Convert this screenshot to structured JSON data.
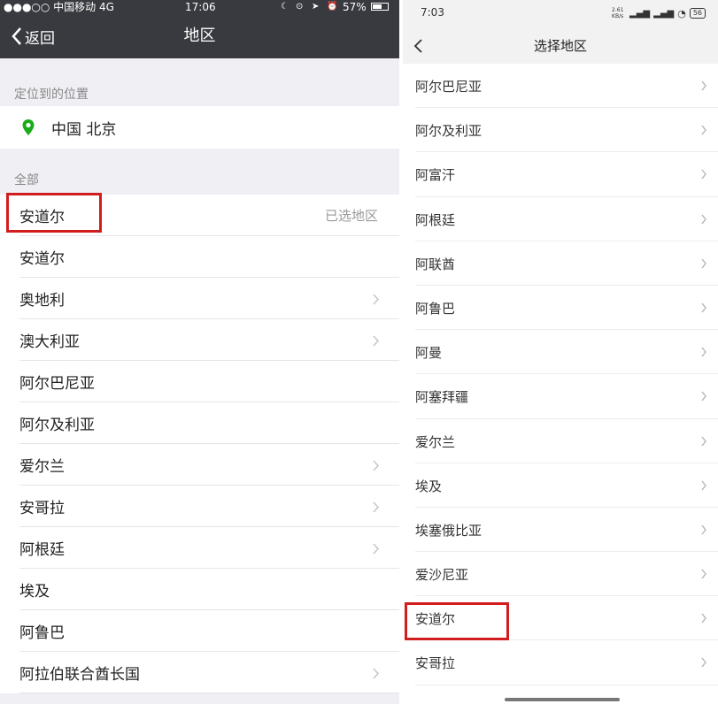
{
  "left": {
    "status": {
      "carrier": "●●●○○ 中国移动",
      "network": "4G",
      "time": "17:06",
      "battery": "57%"
    },
    "nav": {
      "back_label": "返回",
      "title": "地区"
    },
    "location_section": "定位到的位置",
    "location_value": "中国 北京",
    "all_section": "全部",
    "selected_label": "已选地区",
    "rows": [
      {
        "name": "安道尔",
        "chevron": false,
        "selected": true
      },
      {
        "name": "安道尔",
        "chevron": false
      },
      {
        "name": "奥地利",
        "chevron": true
      },
      {
        "name": "澳大利亚",
        "chevron": true
      },
      {
        "name": "阿尔巴尼亚",
        "chevron": false
      },
      {
        "name": "阿尔及利亚",
        "chevron": false
      },
      {
        "name": "爱尔兰",
        "chevron": true
      },
      {
        "name": "安哥拉",
        "chevron": true
      },
      {
        "name": "阿根廷",
        "chevron": true
      },
      {
        "name": "埃及",
        "chevron": false
      },
      {
        "name": "阿鲁巴",
        "chevron": false
      },
      {
        "name": "阿拉伯联合酋长国",
        "chevron": true
      }
    ]
  },
  "right": {
    "status": {
      "time": "7:03",
      "speed": "2.61 KB/s",
      "battery": "56"
    },
    "nav": {
      "title": "选择地区"
    },
    "rows": [
      "阿尔巴尼亚",
      "阿尔及利亚",
      "阿富汗",
      "阿根廷",
      "阿联酋",
      "阿鲁巴",
      "阿曼",
      "阿塞拜疆",
      "爱尔兰",
      "埃及",
      "埃塞俄比亚",
      "爱沙尼亚",
      "安道尔",
      "安哥拉"
    ]
  },
  "colors": {
    "highlight": "#d21d1f",
    "ios_nav": "#393a3f",
    "location_pin": "#1aad19"
  }
}
